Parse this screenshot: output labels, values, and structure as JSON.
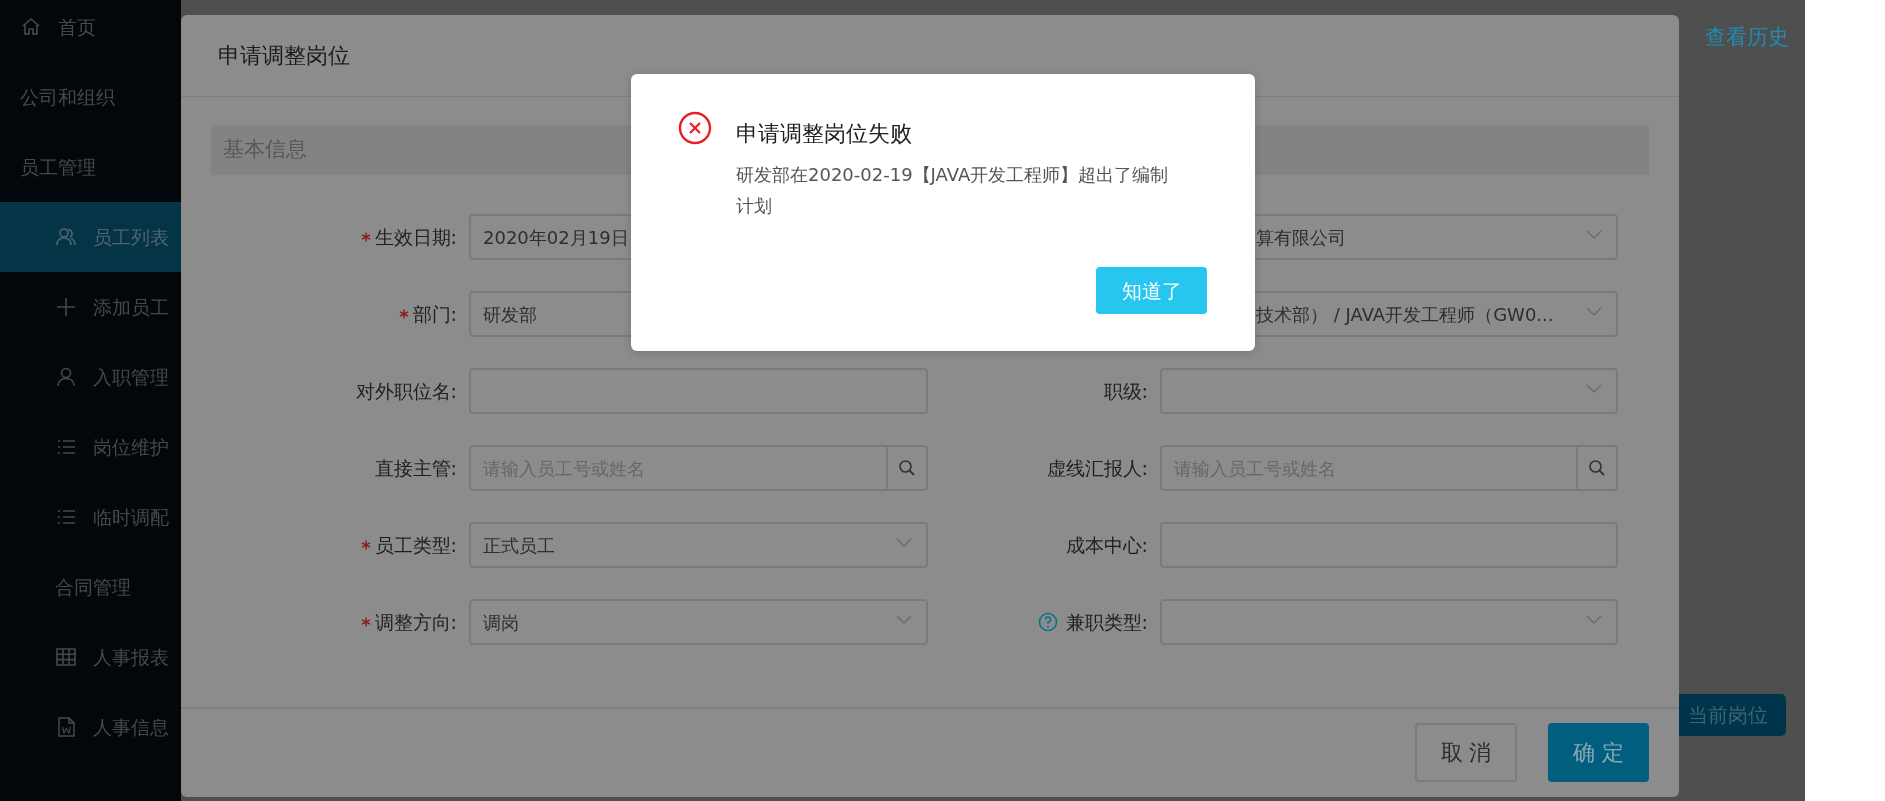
{
  "sidebar": {
    "items": [
      {
        "label": "首页",
        "kind": "home",
        "selected": false
      },
      {
        "label": "公司和组织",
        "selected": false
      },
      {
        "label": "员工管理",
        "selected": false,
        "children": [
          {
            "label": "员工列表",
            "kind": "users",
            "selected": true
          },
          {
            "label": "添加员工",
            "kind": "plus",
            "selected": false
          },
          {
            "label": "入职管理",
            "kind": "user",
            "selected": false
          },
          {
            "label": "岗位维护",
            "kind": "list",
            "selected": false
          },
          {
            "label": "临时调配",
            "kind": "list",
            "selected": false
          },
          {
            "label": "合同管理",
            "selected": false
          },
          {
            "label": "人事报表",
            "kind": "table",
            "selected": false
          },
          {
            "label": "人事信息",
            "kind": "doc",
            "selected": false
          }
        ]
      }
    ]
  },
  "page": {
    "history_link": "查看历史",
    "current_position_button": "当前岗位"
  },
  "modal": {
    "title": "申请调整岗位",
    "section": "基本信息",
    "rows": [
      {
        "left": {
          "label": "生效日期:",
          "required": true,
          "kind": "date",
          "value": "2020年02月19日"
        },
        "right": {
          "kind": "select",
          "value": "算有限公司"
        }
      },
      {
        "left": {
          "label": "部门:",
          "required": true,
          "kind": "select",
          "value": "研发部"
        },
        "right": {
          "kind": "select",
          "value": "技术部） / JAVA开发工程师（GW0..."
        }
      },
      {
        "left": {
          "label": "对外职位名:",
          "required": false,
          "kind": "text"
        },
        "right": {
          "label": "职级:",
          "required": false,
          "kind": "select"
        }
      },
      {
        "left": {
          "label": "直接主管:",
          "required": false,
          "kind": "search",
          "placeholder": "请输入员工号或姓名"
        },
        "right": {
          "label": "虚线汇报人:",
          "required": false,
          "kind": "search",
          "placeholder": "请输入员工号或姓名"
        }
      },
      {
        "left": {
          "label": "员工类型:",
          "required": true,
          "kind": "select",
          "value": "正式员工"
        },
        "right": {
          "label": "成本中心:",
          "required": false,
          "kind": "text"
        }
      },
      {
        "left": {
          "label": "调整方向:",
          "required": true,
          "kind": "select",
          "value": "调岗"
        },
        "right": {
          "label": "兼职类型:",
          "required": false,
          "help": true,
          "kind": "select"
        }
      }
    ],
    "buttons": [
      {
        "label": "取 消",
        "kind": "secondary"
      },
      {
        "label": "确 定",
        "kind": "primary"
      }
    ]
  },
  "alert": {
    "title": "申请调整岗位失败",
    "message": "研发部在2020-02-19【JAVA开发工程师】超出了编制计划",
    "button": "知道了"
  }
}
